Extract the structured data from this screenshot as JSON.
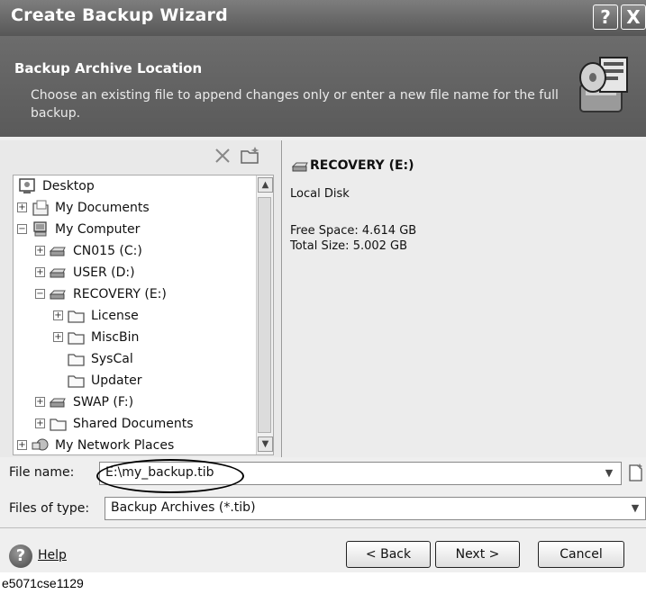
{
  "window": {
    "title": "Create Backup Wizard",
    "help_button": "?",
    "close_button": "X"
  },
  "header": {
    "title": "Backup Archive Location",
    "description": "Choose an existing file to append changes only or enter a new file name for the full backup."
  },
  "tree": {
    "items": [
      {
        "label": "Desktop",
        "icon": "desktop-icon",
        "expander": ""
      },
      {
        "label": "My Documents",
        "icon": "documents-icon",
        "expander": "+"
      },
      {
        "label": "My Computer",
        "icon": "computer-icon",
        "expander": "−"
      },
      {
        "label": "CN015 (C:)",
        "icon": "drive-icon",
        "expander": "+"
      },
      {
        "label": "USER (D:)",
        "icon": "drive-icon",
        "expander": "+"
      },
      {
        "label": "RECOVERY (E:)",
        "icon": "drive-icon",
        "expander": "−"
      },
      {
        "label": "License",
        "icon": "folder-icon",
        "expander": "+"
      },
      {
        "label": "MiscBin",
        "icon": "folder-icon",
        "expander": "+"
      },
      {
        "label": "SysCal",
        "icon": "folder-icon",
        "expander": ""
      },
      {
        "label": "Updater",
        "icon": "folder-icon",
        "expander": ""
      },
      {
        "label": "SWAP (F:)",
        "icon": "drive-icon",
        "expander": "+"
      },
      {
        "label": "Shared Documents",
        "icon": "folder-icon",
        "expander": "+"
      },
      {
        "label": "My Network Places",
        "icon": "network-icon",
        "expander": "+"
      }
    ]
  },
  "details": {
    "drive_name": "RECOVERY (E:)",
    "type": "Local Disk",
    "free_space": "Free Space: 4.614 GB",
    "total_size": "Total Size: 5.002 GB"
  },
  "file": {
    "name_label": "File name:",
    "name_value": "E:\\my_backup.tib",
    "type_label": "Files of type:",
    "type_value": "Backup Archives (*.tib)"
  },
  "buttons": {
    "help": "Help",
    "back": "< Back",
    "next": "Next >",
    "cancel": "Cancel"
  },
  "caption": "e5071cse1129"
}
